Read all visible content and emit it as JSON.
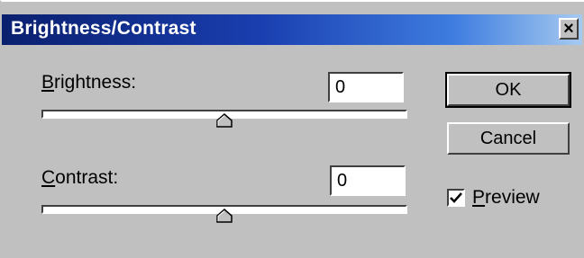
{
  "window": {
    "title": "Brightness/Contrast",
    "close_glyph": "×",
    "close_icon": "close-icon"
  },
  "brightness": {
    "label_first": "B",
    "label_rest": "rightness:",
    "value": "0",
    "slider_level": 0.5
  },
  "contrast": {
    "label_first": "C",
    "label_rest": "ontrast:",
    "value": "0",
    "slider_level": 0.5
  },
  "buttons": {
    "ok_label": "OK",
    "cancel_label": "Cancel"
  },
  "preview": {
    "label_first": "P",
    "label_rest": "review",
    "checked": true,
    "check_icon": "checkmark-icon"
  },
  "colors": {
    "face": "#c0c0c0",
    "title_start": "#0a1f6e",
    "title_end": "#a6caf0"
  }
}
